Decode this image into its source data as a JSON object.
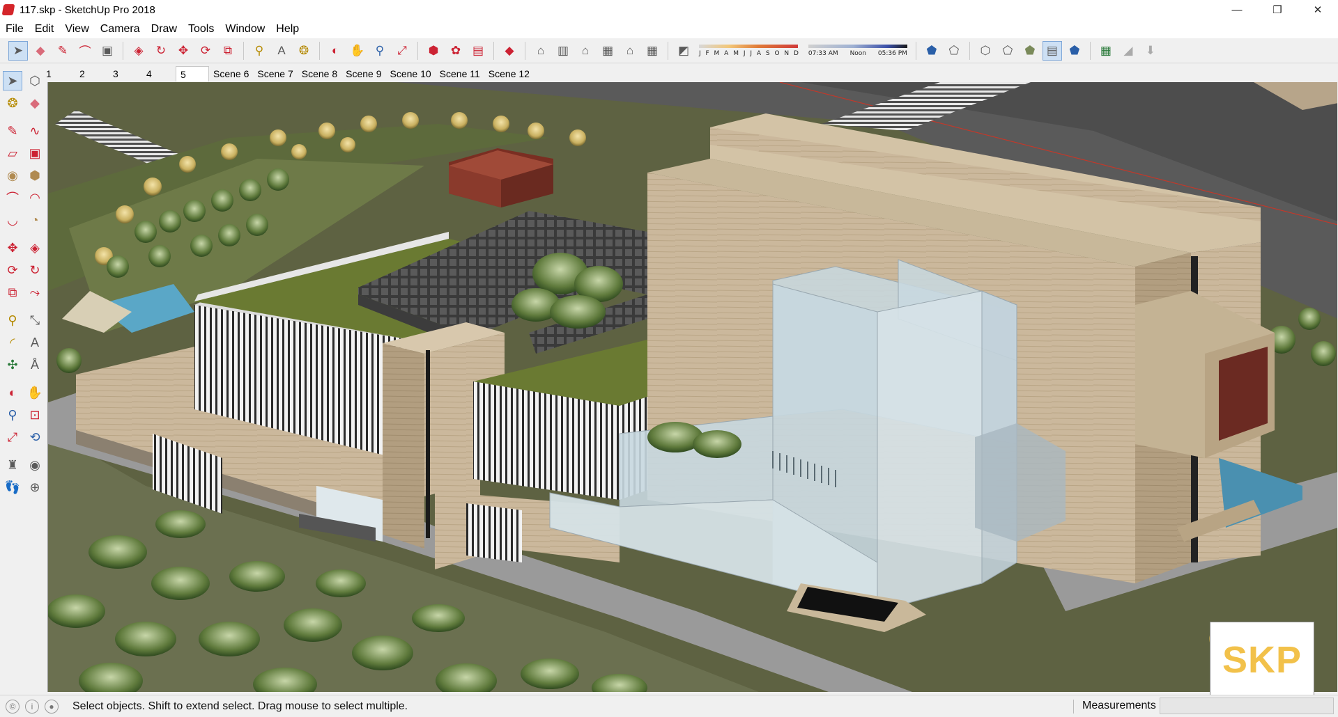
{
  "window": {
    "title": "117.skp - SketchUp Pro 2018",
    "controls": {
      "minimize": "—",
      "restore": "❐",
      "close": "✕"
    }
  },
  "menu": [
    "File",
    "Edit",
    "View",
    "Camera",
    "Draw",
    "Tools",
    "Window",
    "Help"
  ],
  "toolbar": {
    "icons": [
      "select-icon",
      "eraser-icon",
      "pencil-icon",
      "lasso-icon",
      "paint-bucket-icon",
      "push-pull-icon",
      "follow-me-icon",
      "move-icon",
      "rotate-icon",
      "scale-icon",
      "tape-measure-icon",
      "text-icon",
      "paint-icon",
      "orbit-icon",
      "pan-icon",
      "zoom-icon",
      "zoom-extents-icon",
      "3d-warehouse-icon",
      "extension-warehouse-icon",
      "layout-icon",
      "ruby-icon",
      "iso-view-icon",
      "top-view-icon",
      "front-view-icon",
      "right-view-icon",
      "back-view-icon",
      "left-view-icon",
      "shadows-toggle-icon"
    ],
    "shadow_months": "J F M A M J J A S O N D",
    "shadow_times": [
      "07:33 AM",
      "Noon",
      "05:36 PM"
    ],
    "style_icons": [
      "xray-icon",
      "back-edges-icon",
      "wireframe-icon",
      "hidden-line-icon",
      "shaded-icon",
      "shaded-textures-icon",
      "monochrome-icon",
      "section-plane-icon",
      "section-cut-icon",
      "section-fill-icon"
    ]
  },
  "scenes": {
    "tabs": [
      "1",
      "2",
      "3",
      "4",
      "5",
      "Scene 6",
      "Scene 7",
      "Scene 8",
      "Scene 9",
      "Scene 10",
      "Scene 11",
      "Scene 12"
    ],
    "active": "5"
  },
  "left_tools": [
    "select",
    "make-component",
    "paint-bucket",
    "eraser",
    "line",
    "freehand",
    "rectangle",
    "rotated-rectangle",
    "circle",
    "polygon",
    "arc",
    "two-point-arc",
    "three-point-arc",
    "pie",
    "move",
    "push-pull",
    "rotate",
    "follow-me",
    "scale",
    "offset",
    "tape-measure",
    "dimension",
    "protractor",
    "text",
    "axes",
    "3d-text",
    "orbit",
    "pan",
    "zoom",
    "zoom-window",
    "zoom-extents",
    "previous-view",
    "position-camera",
    "look-around",
    "walk",
    "section-plane"
  ],
  "badge": {
    "text": "SKP"
  },
  "status": {
    "message": "Select objects. Shift to extend select. Drag mouse to select multiple.",
    "measurements_label": "Measurements",
    "measurements_value": ""
  },
  "colors": {
    "accent": "#cde0f4",
    "grass": "#6a7048",
    "facade": "#cbb89c",
    "glass": "#c8d8e0",
    "roof_red": "#8a3a2c",
    "badge_yellow": "#f2c14a"
  }
}
